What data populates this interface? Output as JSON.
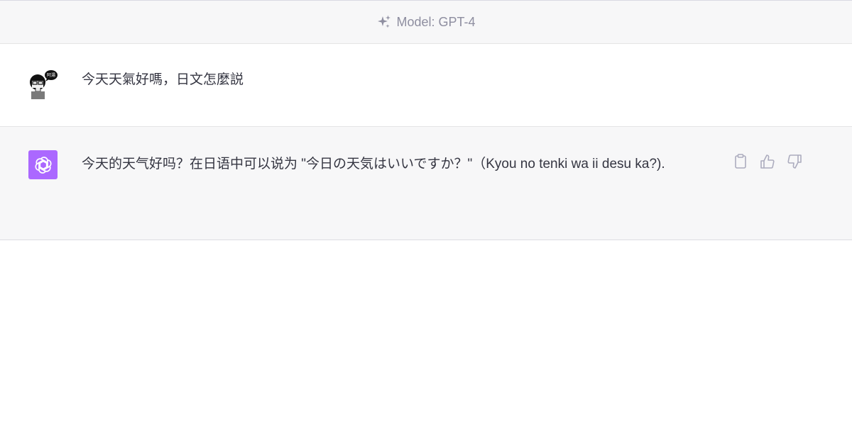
{
  "header": {
    "model_label": "Model: GPT-4",
    "icon": "sparkles-icon"
  },
  "messages": [
    {
      "role": "user",
      "avatar": "user-avatar-cartoon",
      "text": "今天天氣好嗎，日文怎麼説"
    },
    {
      "role": "assistant",
      "avatar": "openai-logo",
      "avatar_color": "#ab68ff",
      "text": "今天的天气好吗？在日语中可以说为 \"今日の天気はいいですか？\"（Kyou no tenki wa ii desu ka?).",
      "actions": [
        "clipboard-icon",
        "thumbs-up-icon",
        "thumbs-down-icon"
      ]
    }
  ],
  "colors": {
    "header_bg": "#f7f7f8",
    "assistant_bg": "#f7f7f8",
    "text": "#343541",
    "muted": "#8e8ea0",
    "accent": "#ab68ff"
  }
}
